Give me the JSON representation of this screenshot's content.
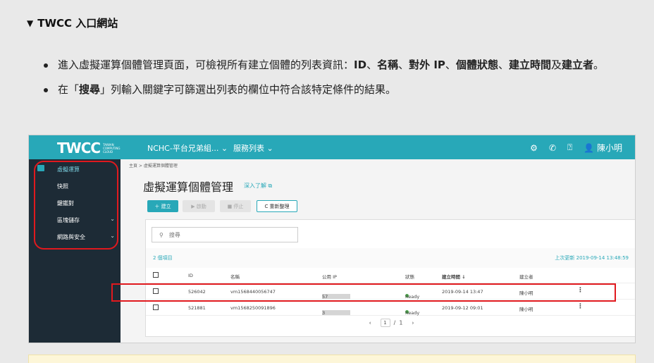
{
  "summary": {
    "label": "TWCC 入口網站"
  },
  "bullets": {
    "b1": {
      "t1": "進入虛擬運算個體管理頁面，可檢視所有建立個體的列表資訊：",
      "id": "ID",
      "s1": "、",
      "name": "名稱",
      "s2": "、",
      "ip": "對外 IP",
      "s3": "、",
      "status": "個體狀態",
      "s4": "、",
      "created": "建立時間",
      "s5": "及",
      "creator": "建立者",
      "end": "。"
    },
    "b2": {
      "t1": "在「",
      "search": "搜尋",
      "t2": "」列輸入關鍵字可篩選出列表的欄位中符合該特定條件的結果。"
    }
  },
  "app": {
    "logo": "TWCC",
    "logo_sub": "TAIWAN COMPUTING CLOUD",
    "project": "NCHC-平台兄弟組... ⌄",
    "services": "服務列表 ⌄",
    "user": "陳小明",
    "sidebar": [
      "虛擬運算",
      "快照",
      "鍵鑑對",
      "區塊儲存",
      "網路與安全"
    ],
    "breadcrumb": "主頁  >  虛擬運算個體管理",
    "title": "虛擬運算個體管理",
    "learn_more": "深入了解 ⧉",
    "buttons": {
      "create": "＋ 建立",
      "start": "▶ 啟動",
      "stop": "■ 停止",
      "refresh": "C 重新整理"
    },
    "search_placeholder": "搜尋",
    "count": "2 個項目",
    "updated": "上次更新 2019-09-14 13:48:59",
    "columns": [
      "ID",
      "名稱",
      "公用 IP",
      "狀態",
      "建立時間 ↓",
      "建立者"
    ],
    "rows": [
      {
        "id": "526042",
        "name": "vm1568440056747",
        "ip_pre": "20",
        "ip_post": "57",
        "status": "Ready",
        "created": "2019-09-14 13:47",
        "creator": "陳小明"
      },
      {
        "id": "521881",
        "name": "vm1568250091896",
        "ip_pre": "20",
        "ip_post": "3",
        "status": "Ready",
        "created": "2019-09-12 09:01",
        "creator": "陳小明"
      }
    ],
    "pager": {
      "prev": "‹",
      "page": "1",
      "sep": "/",
      "total": "1",
      "next": "›"
    }
  },
  "colors": {
    "accent": "#28a8b8",
    "sidebar": "#1d2b36",
    "highlight": "#e0191e"
  }
}
